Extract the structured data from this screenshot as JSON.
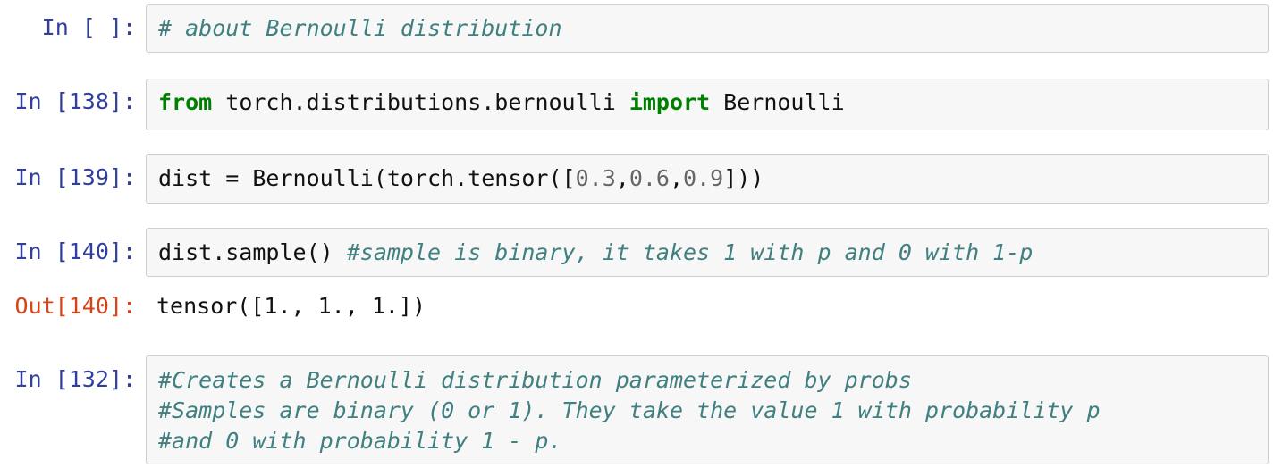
{
  "cells": [
    {
      "prompt": "In [ ]:",
      "lines": [
        {
          "comment": "# about Bernoulli distribution"
        }
      ]
    },
    {
      "prompt": "In [138]:",
      "lines": [
        {
          "kw1": "from",
          "mid": " torch.distributions.bernoulli ",
          "kw2": "import",
          "end": " Bernoulli"
        }
      ]
    },
    {
      "prompt": "In [139]:",
      "lines": [
        {
          "pre": "dist = Bernoulli(torch.tensor([",
          "n1": "0.3",
          "c1": ",",
          "n2": "0.6",
          "c2": ",",
          "n3": "0.9",
          "post": "]))"
        }
      ]
    },
    {
      "prompt": "In [140]:",
      "lines": [
        {
          "code": "dist.sample() ",
          "comment": "#sample is binary, it takes 1 with p and 0 with 1-p"
        }
      ],
      "output_prompt": "Out[140]:",
      "output": "tensor([1., 1., 1.])"
    },
    {
      "prompt": "In [132]:",
      "lines": [
        {
          "comment": "#Creates a Bernoulli distribution parameterized by probs"
        },
        {
          "comment": "#Samples are binary (0 or 1). They take the value 1 with probability p"
        },
        {
          "comment": "#and 0 with probability 1 - p."
        }
      ]
    }
  ]
}
